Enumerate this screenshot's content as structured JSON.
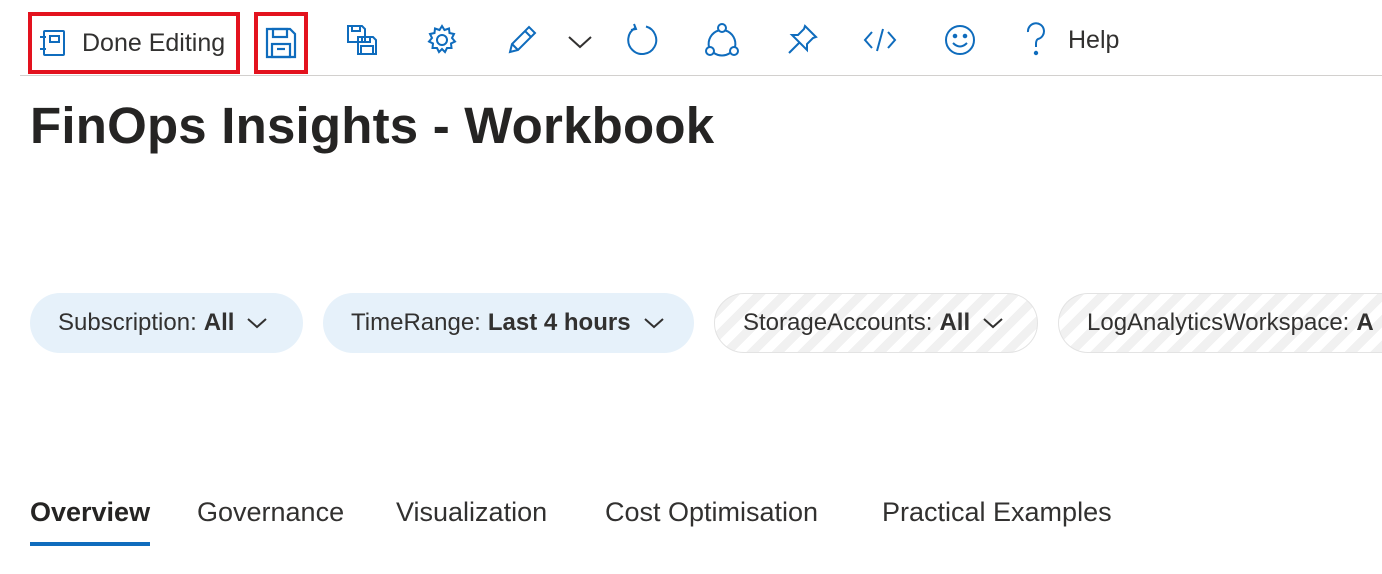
{
  "toolbar": {
    "done_editing_label": "Done Editing",
    "help_label": "Help",
    "icons": [
      "notebook-icon",
      "save-icon",
      "save-as-icon",
      "gear-icon",
      "pencil-icon",
      "chevron-down-icon",
      "refresh-icon",
      "share-icon",
      "pin-icon",
      "code-icon",
      "smiley-icon",
      "question-icon"
    ],
    "accent_color": "#0f6cbd",
    "highlight_color": "#e3121e"
  },
  "page": {
    "title": "FinOps Insights - Workbook"
  },
  "parameters": [
    {
      "label": "Subscription:",
      "value": "All"
    },
    {
      "label": "TimeRange:",
      "value": "Last 4 hours"
    },
    {
      "label": "StorageAccounts:",
      "value": "All"
    },
    {
      "label": "LogAnalyticsWorkspace:",
      "value": "A"
    }
  ],
  "tabs": [
    {
      "label": "Overview",
      "active": true
    },
    {
      "label": "Governance",
      "active": false
    },
    {
      "label": "Visualization",
      "active": false
    },
    {
      "label": "Cost Optimisation",
      "active": false
    },
    {
      "label": "Practical Examples",
      "active": false
    }
  ]
}
